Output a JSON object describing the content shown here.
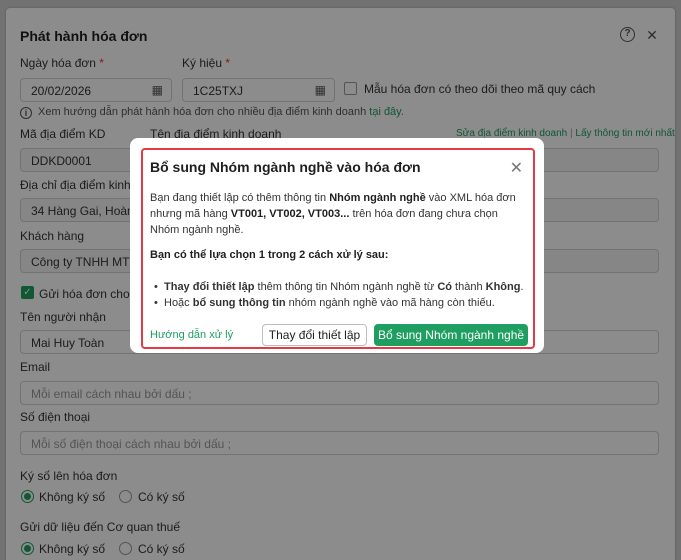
{
  "panel": {
    "title": "Phát hành hóa đơn",
    "invoice_date_label": "Ngày hóa đơn",
    "invoice_date_value": "20/02/2026",
    "symbol_label": "Ký hiệu",
    "symbol_value": "1C25TXJ",
    "required_mark": "*",
    "template_checkbox_label": "Mẫu hóa đơn có theo dõi theo mã quy cách",
    "guide_text": "Xem hướng dẫn phát hành hóa đơn cho nhiều địa điểm kinh doanh",
    "guide_link": "tại đây.",
    "location_code_label": "Mã địa điểm KD",
    "location_code_value": "DDKD0001",
    "location_name_label": "Tên địa điểm kinh doanh",
    "edit_location_link": "Sửa địa điểm kinh doanh",
    "separator": "|",
    "fetch_latest_link": "Lấy thông tin mới nhất",
    "address_label": "Địa chỉ địa điểm kinh d",
    "address_value": "34 Hàng Gai, Hoàn K",
    "customer_label": "Khách hàng",
    "customer_value": "Công ty TNHH MTV",
    "send_invoice_label": "Gửi hóa đơn cho k",
    "receiver_label": "Tên người nhận",
    "receiver_value": "Mai Huy Toàn",
    "email_label": "Email",
    "email_placeholder": "Mỗi email cách nhau bởi dấu ;",
    "phone_label": "Số điện thoại",
    "phone_placeholder": "Mỗi số điện thoại cách nhau bởi dấu ;",
    "sign_label": "Ký số lên hóa đơn",
    "no_sign": "Không ký số",
    "yes_sign": "Có ký số",
    "send_tax_label": "Gửi dữ liệu đến Cơ quan thuế",
    "send_no_sign": "Không ký số",
    "send_yes_sign": "Có ký số"
  },
  "modal": {
    "title": "Bổ sung Nhóm ngành nghề vào hóa đơn",
    "p1_a": "Bạn đang thiết lập có thêm thông tin ",
    "p1_b": "Nhóm ngành nghề",
    "p1_c": " vào XML hóa đơn",
    "p1_d": "nhưng mã hàng ",
    "p1_e": "VT001, VT002, VT003...",
    "p1_f": " trên hóa đơn đang chưa chọn",
    "p1_g": "Nhóm ngành nghề.",
    "p2": "Bạn có thể lựa chọn 1 trong 2 cách xử lý sau:",
    "b1_a": "Thay đổi thiết lập",
    "b1_b": " thêm thông tin Nhóm ngành nghề từ ",
    "b1_c": "Có",
    "b1_d": " thành ",
    "b1_e": "Không",
    "b1_f": ".",
    "b2_a": "Hoặc ",
    "b2_b": "bổ sung thông tin",
    "b2_c": " nhóm ngành nghề vào mã hàng còn thiếu.",
    "guide": "Hướng dẫn xử lý",
    "change_settings": "Thay đổi thiết lập",
    "add_group": "Bổ sung Nhóm ngành nghề"
  },
  "colors": {
    "accent": "#1e9e60",
    "alert_border": "#e53945"
  },
  "icons": {
    "help": "help-circle-icon",
    "close": "close-icon",
    "calendar": "calendar-icon",
    "info": "info-icon"
  }
}
